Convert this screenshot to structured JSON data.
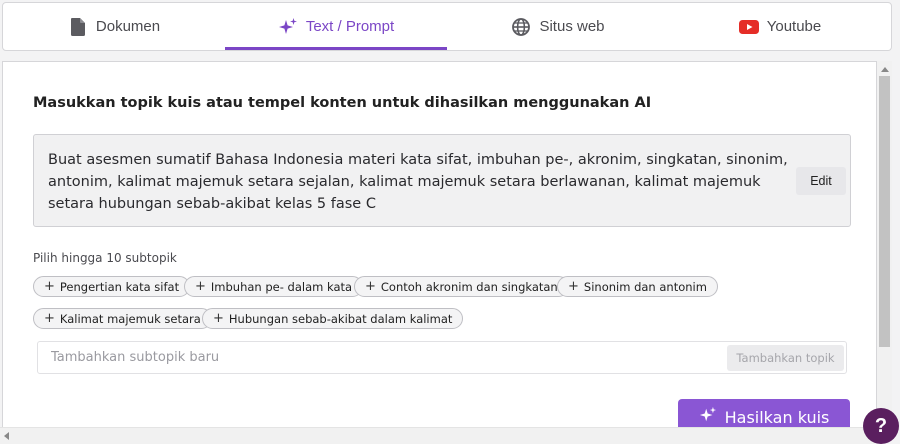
{
  "tabs": [
    {
      "label": "Dokumen",
      "icon": "document-icon"
    },
    {
      "label": "Text / Prompt",
      "icon": "sparkle-icon",
      "active": true
    },
    {
      "label": "Situs web",
      "icon": "globe-icon"
    },
    {
      "label": "Youtube",
      "icon": "youtube-icon"
    }
  ],
  "heading": "Masukkan topik kuis atau tempel konten untuk dihasilkan menggunakan AI",
  "topic": {
    "text": "Buat asesmen sumatif Bahasa Indonesia materi kata sifat, imbuhan pe-, akronim, singkatan, sinonim, antonim, kalimat majemuk setara sejalan, kalimat majemuk setara berlawanan, kalimat majemuk setara hubungan sebab-akibat kelas 5 fase C",
    "edit_label": "Edit"
  },
  "subtopics": {
    "title": "Pilih hingga 10 subtopik",
    "chips": [
      "Pengertian kata sifat",
      "Imbuhan pe- dalam kata",
      "Contoh akronim dan singkatan",
      "Sinonim dan antonim",
      "Kalimat majemuk setara",
      "Hubungan sebab-akibat dalam kalimat"
    ]
  },
  "add_subtopic": {
    "placeholder": "Tambahkan subtopik baru",
    "value": "",
    "button_label": "Tambahkan topik"
  },
  "generate_label": "Hasilkan kuis",
  "help_label": "?",
  "colors": {
    "accent": "#7b46c6",
    "generate": "#8a56d4",
    "youtube": "#e52d27",
    "help": "#5a1f5f"
  }
}
